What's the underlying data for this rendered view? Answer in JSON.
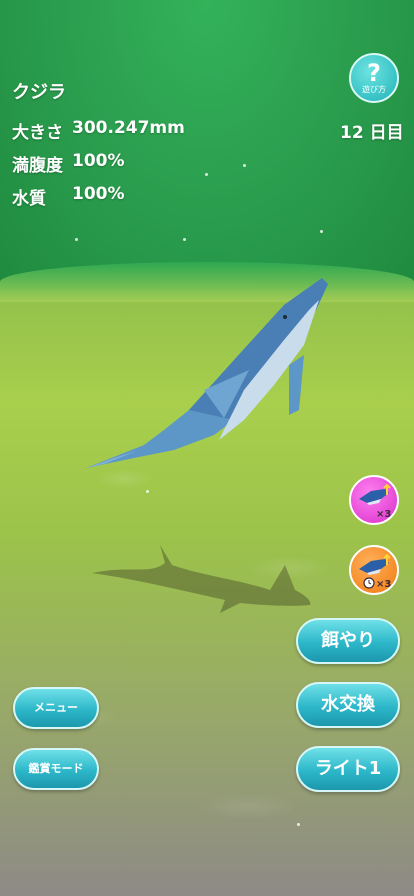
{
  "whale": {
    "name": "クジラ"
  },
  "stats": {
    "size_label": "大きさ",
    "size_value": "300.247mm",
    "fullness_label": "満腹度",
    "fullness_value": "100%",
    "water_label": "水質",
    "water_value": "100%"
  },
  "day": "12 日目",
  "help": {
    "symbol": "?",
    "label": "遊び方"
  },
  "boosts": {
    "boost1_multiplier": "×3",
    "boost2_multiplier": "×3"
  },
  "actions": {
    "feed": "餌やり",
    "water_change": "水交換",
    "light": "ライト1"
  },
  "menu": {
    "menu_label": "メニュー",
    "viewing_mode": "鑑賞モード"
  },
  "colors": {
    "button_accent": "#2cb7c9",
    "boost_pink": "#d92fc9",
    "boost_orange": "#f07a10"
  }
}
